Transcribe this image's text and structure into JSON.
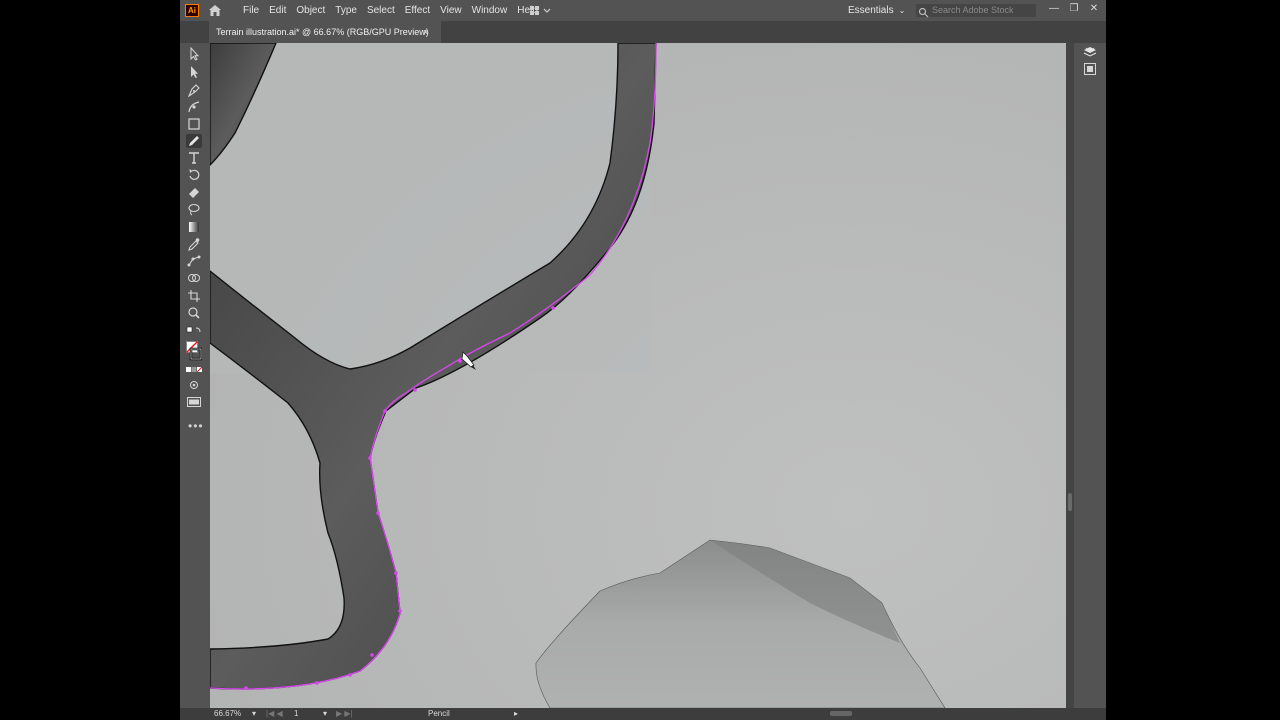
{
  "app": {
    "logo_text": "Ai"
  },
  "menubar": {
    "items": [
      "File",
      "Edit",
      "Object",
      "Type",
      "Select",
      "Effect",
      "View",
      "Window",
      "Help"
    ],
    "workspace": "Essentials",
    "search_placeholder": "Search Adobe Stock"
  },
  "document": {
    "tab_title": "Terrain illustration.ai* @ 66.67% (RGB/GPU Preview)",
    "close_glyph": "×"
  },
  "toolbar": {
    "active_tool": "pencil",
    "more_glyph": "•••"
  },
  "statusbar": {
    "zoom": "66.67%",
    "artboard": "1",
    "current_tool": "Pencil"
  },
  "colors": {
    "chrome": "#535353",
    "canvas": "#b6b7b7",
    "selection": "#d946ef"
  }
}
